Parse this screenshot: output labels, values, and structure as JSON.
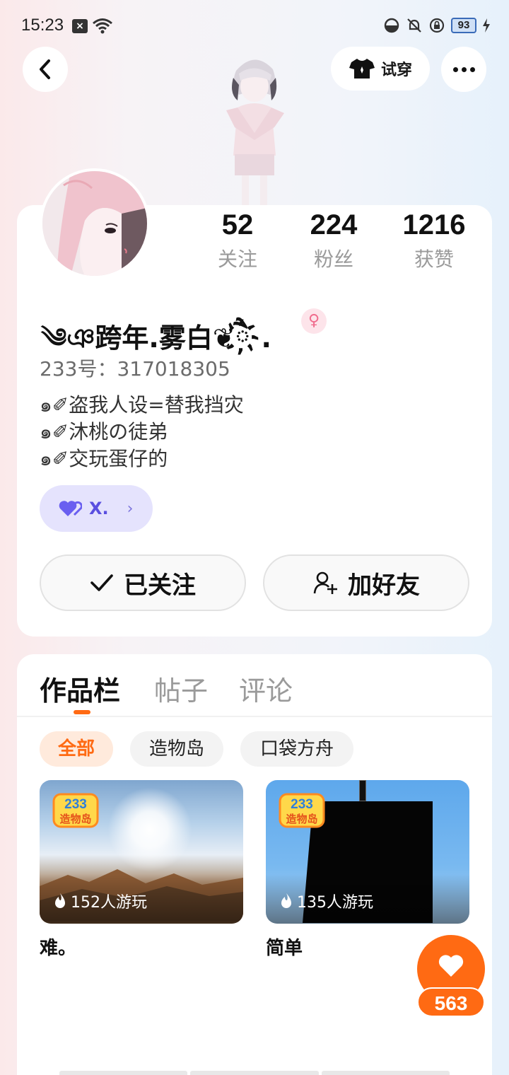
{
  "status_bar": {
    "time": "15:23",
    "battery": "93"
  },
  "header": {
    "try_on_label": "试穿"
  },
  "profile": {
    "stats": [
      {
        "value": "52",
        "label": "关注"
      },
      {
        "value": "224",
        "label": "粉丝"
      },
      {
        "value": "1216",
        "label": "获赞"
      }
    ],
    "nickname": "༄ঞ跨年.雾白❦ཻ҉.",
    "gender_symbol": "♀",
    "uid": "233号：317018305",
    "bio": [
      "๑✐盗我人设=替我挡灾",
      "๑✐沐桃の徒弟",
      "๑✐交玩蛋仔的"
    ],
    "family_label": "X.",
    "follow_label": "已关注",
    "add_friend_label": "加好友"
  },
  "tabs": [
    "作品栏",
    "帖子",
    "评论"
  ],
  "filters": [
    "全部",
    "造物岛",
    "口袋方舟"
  ],
  "works": [
    {
      "title": "难。",
      "play_count": "152人游玩",
      "logo_text": "233",
      "logo_sub": "造物岛"
    },
    {
      "title": "简单",
      "play_count": "135人游玩",
      "logo_text": "233",
      "logo_sub": "造物岛"
    }
  ],
  "like": {
    "count": "563"
  },
  "colors": {
    "accent": "#ff6a13",
    "family_purple": "#5a4fe0",
    "gender_pink": "#f06c8d"
  },
  "icons": {
    "back": "chevron-left-icon",
    "try_on": "tshirt-icon",
    "more": "more-dots-icon",
    "gender": "female-icon",
    "family": "heart-icon",
    "follow": "check-icon",
    "add_friend": "add-user-icon",
    "play": "flame-icon",
    "like": "heart-icon"
  }
}
